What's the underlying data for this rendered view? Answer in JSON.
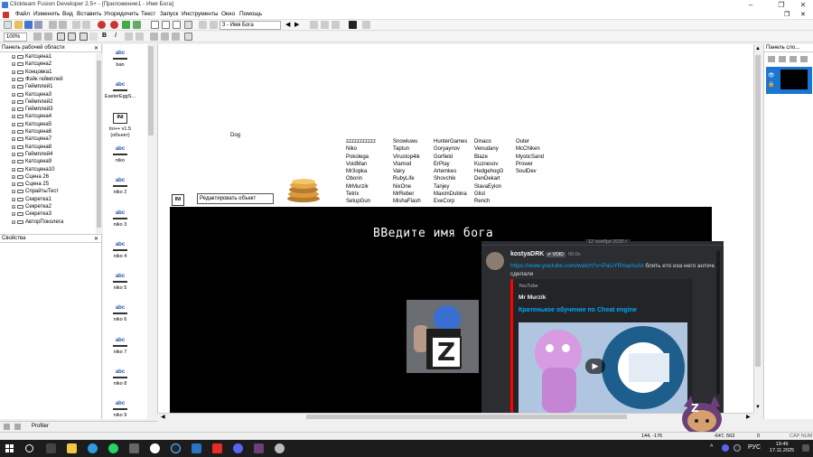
{
  "window": {
    "title": "Clickteam Fusion Developer 2.5+ - [Приложение1 - Имя Бога]",
    "controls": [
      "–",
      "❐",
      "✕"
    ]
  },
  "menu": [
    "Файл",
    "Изменить",
    "Вид",
    "Вставить",
    "Упорядочить",
    "Текст",
    "Запуск",
    "Инструменты",
    "Окно",
    "Помощь"
  ],
  "toolbar": {
    "zoom": "100%",
    "frame_select": "3 - Имя Бога"
  },
  "workspace": {
    "header": "Панель рабочей области",
    "items": [
      "Катсцена1",
      "Катсцена2",
      "Концовка1",
      "Фэйк геймплей",
      "Геймплей1",
      "Катсцена3",
      "Геймплей2",
      "Геймплей3",
      "Катсцена4",
      "Катсцена5",
      "Катсцена6",
      "Катсцена7",
      "Катсцена8",
      "Геймплей4",
      "Катсцена9",
      "Катсцена10",
      "Сцена 26",
      "Сцена 25",
      "СпрайтыТест",
      "Секретка1",
      "Секретка2",
      "Секретка3",
      "АвторПоколега"
    ]
  },
  "properties": {
    "header": "Свойства"
  },
  "library": {
    "items": [
      {
        "icon": "abc",
        "label": "ban"
      },
      {
        "icon": "abc",
        "label": "EasterEggS..."
      },
      {
        "icon": "ini",
        "label": "Ini++ v1.5 (объект)"
      },
      {
        "icon": "abc",
        "label": "niko"
      },
      {
        "icon": "abc",
        "label": "niko 2"
      },
      {
        "icon": "abc",
        "label": "niko 3"
      },
      {
        "icon": "abc",
        "label": "niko 4"
      },
      {
        "icon": "abc",
        "label": "niko 5"
      },
      {
        "icon": "abc",
        "label": "niko 6"
      },
      {
        "icon": "abc",
        "label": "niko 7"
      },
      {
        "icon": "abc",
        "label": "niko 8"
      },
      {
        "icon": "abc",
        "label": "niko 9"
      }
    ],
    "icon_text": {
      "abc": "abc",
      "ini": "INI"
    }
  },
  "frame": {
    "dog_label": "Dog",
    "edit_field_value": "Редактировать объект",
    "ini_icon": "INI",
    "names": [
      [
        "zzzzzzzzzzz",
        "Niko",
        "Pokolega",
        "VoidMan",
        "Mr3opka",
        "Oborin",
        "MrMurzik",
        "Tetrix",
        "SetupGun"
      ],
      [
        "Snowluwu",
        "Taptun",
        "Virustop4ik",
        "Vlamod",
        "Vairy",
        "RubyLife",
        "NixOne",
        "MrReber",
        "MishaFlash"
      ],
      [
        "HunterGames",
        "Goryaynov",
        "Gorfield",
        "ErPlay",
        "Artemkes",
        "Shovchik",
        "Tanjey",
        "MaximDubina",
        "ExeCorp"
      ],
      [
        "Dinaco",
        "Venudany",
        "Blaze",
        "Kuznesov",
        "HedgehogG",
        "DenDekart",
        "SlavaEylon",
        "Glist",
        "Rench"
      ],
      [
        "Outer",
        "McChiken",
        "MysticSand",
        "Prower",
        "SoulDev"
      ]
    ],
    "game_title": "ВВедите имя бога",
    "z_letter": "Z"
  },
  "discord": {
    "date_divider": "12 ноября 2025 г.",
    "username": "kostyaDRK",
    "badge": "VOID",
    "time": "00:0x",
    "link": "https://www.youtube.com/watch?v=PaUYRmaAsAk",
    "message": "блять ето иза него античит сделали",
    "embed": {
      "provider": "YouTube",
      "author": "Mr Murzik",
      "title": "Кратенькое обучение по Cheat engine"
    }
  },
  "right_panel": {
    "header": "Панель сло..."
  },
  "status": {
    "profiler": "Profiler",
    "coords": "144, -176",
    "coords2": "-647, 563",
    "zero": "0",
    "caps": "CAP NUM"
  },
  "taskbar": {
    "time": "19:49",
    "date": "17.11.2025",
    "lang": "РУС"
  },
  "colors": {
    "accent": "#3a7bd5",
    "discord_bg": "#2b2d31",
    "discord_link": "#00a8fc",
    "youtube_red": "#ff0000",
    "embed_title": "#00a8fc"
  }
}
